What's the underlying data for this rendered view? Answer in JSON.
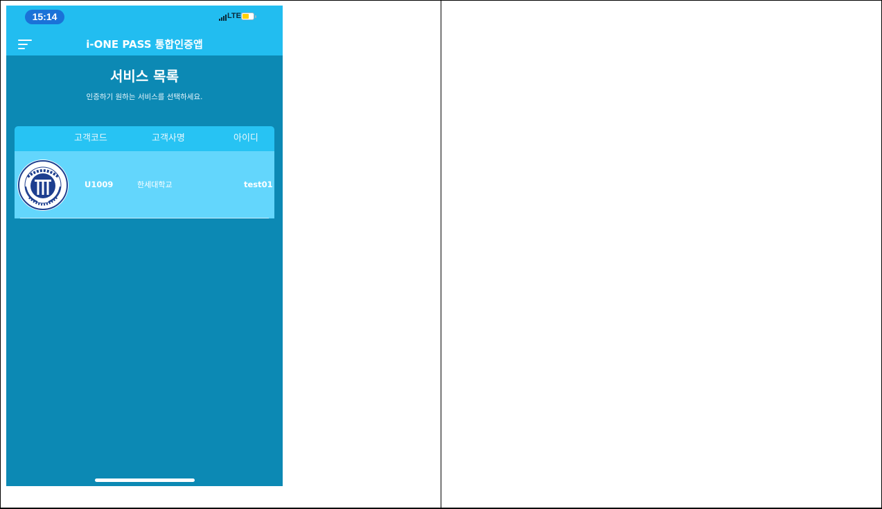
{
  "status_bar": {
    "time": "15:14",
    "network": "LTE",
    "battery_level": 0.6,
    "icons": [
      "signal-icon",
      "battery-icon"
    ]
  },
  "app_bar": {
    "title": "i-ONE PASS 통합인증앱",
    "menu_icon": "menu-icon"
  },
  "page": {
    "heading": "서비스 목록",
    "subtitle": "인증하기 원하는 서비스를 선택하세요."
  },
  "table": {
    "columns": [
      "고객코드",
      "고객사명",
      "아이디"
    ],
    "rows": [
      {
        "logo": "university-logo",
        "logo_text": "한세대학교 · HANSEI UNIVERSITY",
        "code": "U1009",
        "name": "한세대학교",
        "id": "test01"
      }
    ]
  },
  "colors": {
    "app_bar": "#22bdf0",
    "background": "#0c89b4",
    "table_header": "#27c3f3",
    "table_row": "#63d6fc",
    "time_pill": "#1a72d8"
  }
}
